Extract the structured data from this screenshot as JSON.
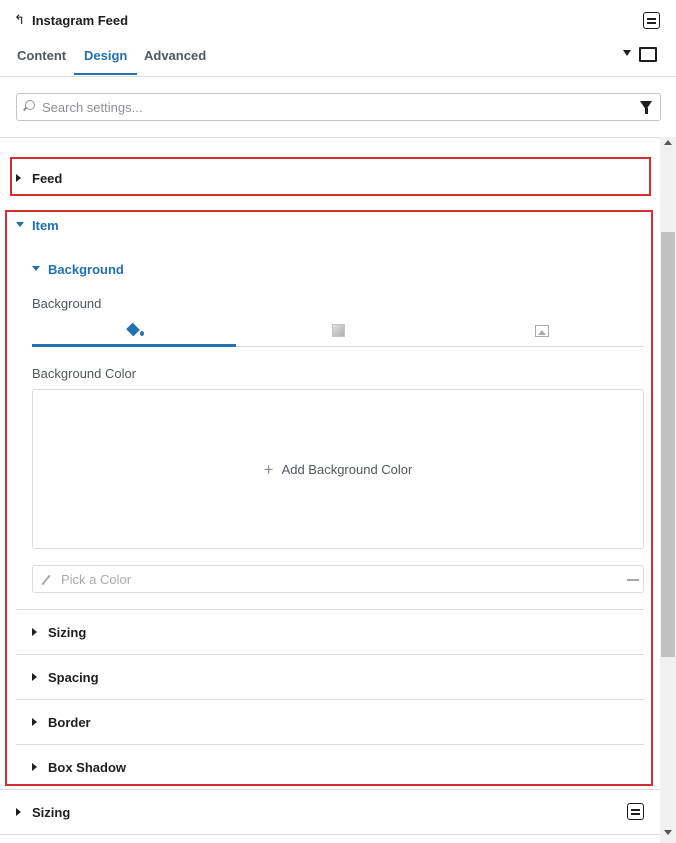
{
  "header": {
    "title": "Instagram Feed"
  },
  "tabs": [
    {
      "label": "Content",
      "active": false
    },
    {
      "label": "Design",
      "active": true
    },
    {
      "label": "Advanced",
      "active": false
    }
  ],
  "search": {
    "placeholder": "Search settings...",
    "value": ""
  },
  "sections": {
    "feed": {
      "label": "Feed",
      "expanded": false
    },
    "item": {
      "label": "Item",
      "expanded": true,
      "background": {
        "label": "Background",
        "expanded": true,
        "field_label": "Background",
        "bg_tabs": [
          "paint-bucket-icon",
          "gradient-icon",
          "image-icon"
        ],
        "active_bg_tab": "paint-bucket-icon",
        "color_label": "Background Color",
        "add_color": "Add Background Color",
        "pick_placeholder": "Pick a Color"
      },
      "subsections": [
        "Sizing",
        "Spacing",
        "Border",
        "Box Shadow"
      ]
    },
    "sizing": {
      "label": "Sizing",
      "expanded": false
    }
  },
  "colors": {
    "accent": "#2271b1",
    "highlight": "#d42e32"
  }
}
